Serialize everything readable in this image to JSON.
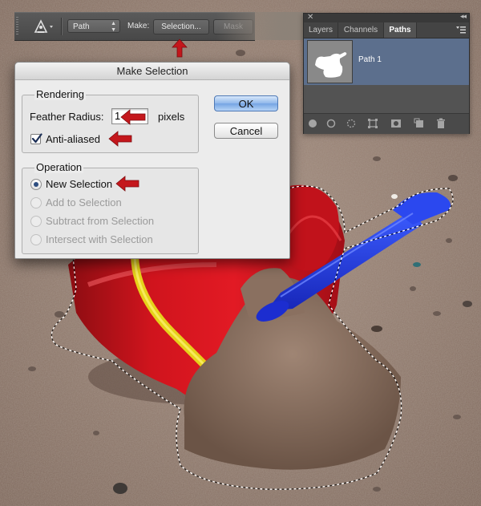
{
  "options_bar": {
    "path_mode": "Path",
    "make_label": "Make:",
    "selection_button": "Selection...",
    "mask_button": "Mask",
    "tool_icon": "pen-tool-icon"
  },
  "dialog": {
    "title": "Make Selection",
    "rendering": {
      "title": "Rendering",
      "feather_label": "Feather Radius:",
      "feather_value": "1",
      "feather_unit": "pixels",
      "anti_aliased_label": "Anti-aliased",
      "anti_aliased_checked": true
    },
    "operation": {
      "title": "Operation",
      "options": [
        "New Selection",
        "Add to Selection",
        "Subtract from Selection",
        "Intersect with Selection"
      ],
      "selected": "New Selection"
    },
    "ok_label": "OK",
    "cancel_label": "Cancel"
  },
  "panel": {
    "tabs": [
      "Layers",
      "Channels",
      "Paths"
    ],
    "active_tab": "Paths",
    "path_item": "Path 1",
    "footer_icons": [
      "fill-path-icon",
      "stroke-path-icon",
      "load-as-selection-icon",
      "make-work-path-icon",
      "add-mask-icon",
      "new-path-icon",
      "delete-icon"
    ]
  },
  "colors": {
    "annotation_arrow": "#c4171c",
    "panel_selected_row": "#5c6f8d",
    "ok_button_blue": "#8fb7ea"
  }
}
